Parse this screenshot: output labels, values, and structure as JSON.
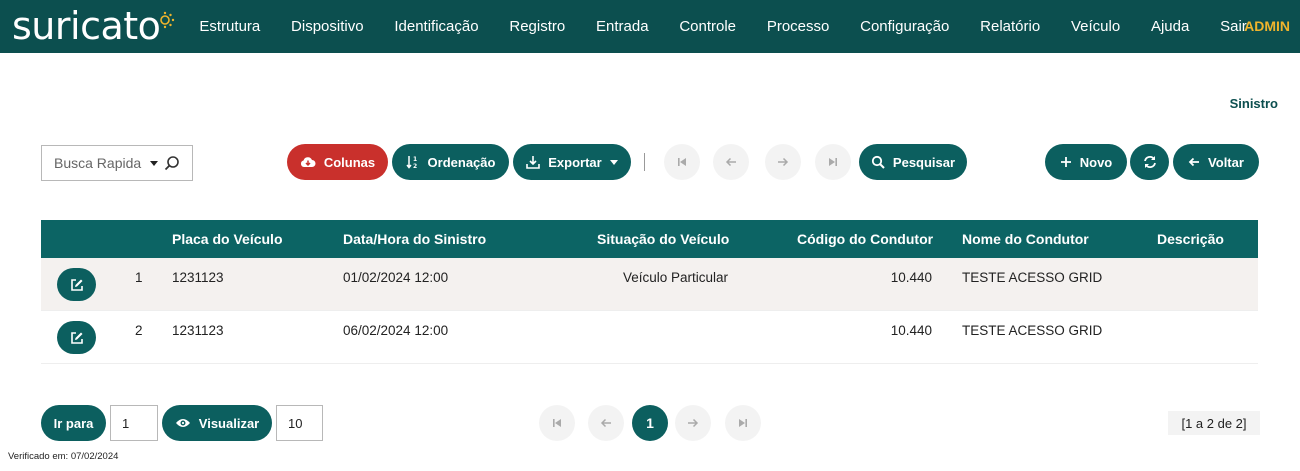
{
  "header": {
    "logo_text": "suricato",
    "menu": [
      "Estrutura",
      "Dispositivo",
      "Identificação",
      "Registro",
      "Entrada",
      "Controle",
      "Processo",
      "Configuração",
      "Relatório",
      "Veículo",
      "Ajuda",
      "Sair"
    ],
    "user": "ADMIN"
  },
  "page_title": "Sinistro",
  "toolbar": {
    "search_placeholder": "Busca Rapida",
    "columns_label": "Colunas",
    "sort_label": "Ordenação",
    "export_label": "Exportar",
    "search_label": "Pesquisar",
    "new_label": "Novo",
    "back_label": "Voltar"
  },
  "table": {
    "columns": [
      "Placa do Veículo",
      "Data/Hora do Sinistro",
      "Situação do Veículo",
      "Código do Condutor",
      "Nome do Condutor",
      "Descrição"
    ],
    "rows": [
      {
        "index": "1",
        "placa": "1231123",
        "data": "01/02/2024 12:00",
        "situacao": "Veículo Particular",
        "codigo": "10.440",
        "nome": "TESTE ACESSO GRID",
        "descricao": ""
      },
      {
        "index": "2",
        "placa": "1231123",
        "data": "06/02/2024 12:00",
        "situacao": "",
        "codigo": "10.440",
        "nome": "TESTE ACESSO GRID",
        "descricao": ""
      }
    ]
  },
  "pagination": {
    "goto_label": "Ir para",
    "goto_value": "1",
    "view_label": "Visualizar",
    "view_value": "10",
    "current_page": "1",
    "range_text": "[1 a 2 de 2]"
  },
  "footer": {
    "verified": "Verificado em: 07/02/2024"
  },
  "icons": {
    "cloud_download": "cloud-download-icon",
    "sort": "sort-icon",
    "export": "download-icon",
    "search": "search-icon",
    "plus": "plus-icon",
    "refresh": "refresh-icon",
    "back": "arrow-left-icon",
    "edit": "edit-icon",
    "view": "eye-icon"
  },
  "colors": {
    "header_bg": "#0c4f4f",
    "primary": "#0c5f5f",
    "danger": "#c9302c",
    "accent": "#f0b42c",
    "table_header": "#0c6464"
  }
}
